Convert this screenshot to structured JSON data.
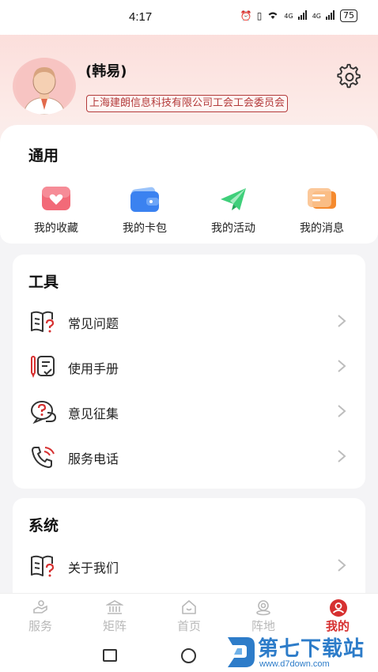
{
  "status_bar": {
    "time": "4:17",
    "battery": "75",
    "signal_1": "4G",
    "signal_2": "4G"
  },
  "profile": {
    "name": "(韩易)",
    "organization": "上海建朗信息科技有限公司工会工会委员会"
  },
  "general": {
    "title": "通用",
    "items": [
      {
        "label": "我的收藏",
        "icon": "heart-icon"
      },
      {
        "label": "我的卡包",
        "icon": "wallet-icon"
      },
      {
        "label": "我的活动",
        "icon": "flag-icon"
      },
      {
        "label": "我的消息",
        "icon": "message-icon"
      }
    ]
  },
  "tools": {
    "title": "工具",
    "items": [
      {
        "label": "常见问题",
        "icon": "faq-book-icon"
      },
      {
        "label": "使用手册",
        "icon": "manual-icon"
      },
      {
        "label": "意见征集",
        "icon": "feedback-icon"
      },
      {
        "label": "服务电话",
        "icon": "phone-icon"
      }
    ]
  },
  "system": {
    "title": "系统",
    "items": [
      {
        "label": "关于我们",
        "icon": "about-icon"
      }
    ]
  },
  "tabbar": {
    "items": [
      {
        "label": "服务",
        "icon": "service-icon"
      },
      {
        "label": "矩阵",
        "icon": "bank-icon"
      },
      {
        "label": "首页",
        "icon": "home-icon"
      },
      {
        "label": "阵地",
        "icon": "location-icon"
      },
      {
        "label": "我的",
        "icon": "user-icon",
        "active": true
      }
    ]
  },
  "watermark": {
    "brand": "第七下载站",
    "url": "www.d7down.com"
  },
  "colors": {
    "accent": "#d63030",
    "org_tag": "#b33a3a",
    "watermark": "#2d7cc9"
  }
}
